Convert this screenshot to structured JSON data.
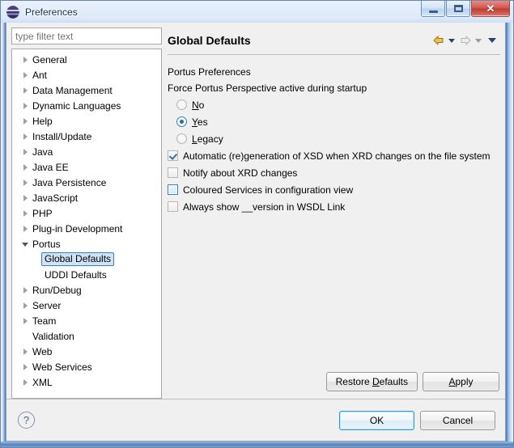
{
  "window": {
    "title": "Preferences",
    "icon": "eclipse-globe-icon",
    "minimize_label": "",
    "maximize_label": "",
    "close_label": "✕"
  },
  "filter": {
    "placeholder": "type filter text",
    "value": ""
  },
  "tree": {
    "items": [
      {
        "label": "General",
        "state": "collapsed",
        "level": 0
      },
      {
        "label": "Ant",
        "state": "collapsed",
        "level": 0
      },
      {
        "label": "Data Management",
        "state": "collapsed",
        "level": 0
      },
      {
        "label": "Dynamic Languages",
        "state": "collapsed",
        "level": 0
      },
      {
        "label": "Help",
        "state": "collapsed",
        "level": 0
      },
      {
        "label": "Install/Update",
        "state": "collapsed",
        "level": 0
      },
      {
        "label": "Java",
        "state": "collapsed",
        "level": 0
      },
      {
        "label": "Java EE",
        "state": "collapsed",
        "level": 0
      },
      {
        "label": "Java Persistence",
        "state": "collapsed",
        "level": 0
      },
      {
        "label": "JavaScript",
        "state": "collapsed",
        "level": 0
      },
      {
        "label": "PHP",
        "state": "collapsed",
        "level": 0
      },
      {
        "label": "Plug-in Development",
        "state": "collapsed",
        "level": 0
      },
      {
        "label": "Portus",
        "state": "expanded",
        "level": 0
      },
      {
        "label": "Global Defaults",
        "state": "leaf",
        "level": 1,
        "selected": true
      },
      {
        "label": "UDDI Defaults",
        "state": "leaf",
        "level": 1
      },
      {
        "label": "Run/Debug",
        "state": "collapsed",
        "level": 0
      },
      {
        "label": "Server",
        "state": "collapsed",
        "level": 0
      },
      {
        "label": "Team",
        "state": "collapsed",
        "level": 0
      },
      {
        "label": "Validation",
        "state": "leaf-top",
        "level": 0
      },
      {
        "label": "Web",
        "state": "collapsed",
        "level": 0
      },
      {
        "label": "Web Services",
        "state": "collapsed",
        "level": 0
      },
      {
        "label": "XML",
        "state": "collapsed",
        "level": 0
      }
    ]
  },
  "panel": {
    "title": "Global Defaults",
    "nav": {
      "back_icon": "arrow-left-icon",
      "back_menu_icon": "chevron-down-icon",
      "forward_icon": "arrow-right-icon",
      "forward_menu_icon": "chevron-down-icon",
      "more_icon": "chevron-down-icon"
    },
    "group_label": "Portus Preferences",
    "startup_label": "Force Portus Perspective active during startup",
    "radios": [
      {
        "label_pre": "",
        "mnemonic": "N",
        "label_post": "o",
        "checked": false
      },
      {
        "label_pre": "",
        "mnemonic": "Y",
        "label_post": "es",
        "checked": true
      },
      {
        "label_pre": "",
        "mnemonic": "L",
        "label_post": "egacy",
        "checked": false
      }
    ],
    "checkboxes": [
      {
        "label": "Automatic (re)generation of XSD when XRD changes on the file system",
        "checked": true,
        "hover": false
      },
      {
        "label": "Notify about XRD changes",
        "checked": false,
        "hover": false
      },
      {
        "label": "Coloured Services in configuration view",
        "checked": false,
        "hover": true
      },
      {
        "label": "Always show __version in WSDL Link",
        "checked": false,
        "hover": false
      }
    ],
    "restore_defaults": {
      "pre": "Restore ",
      "mnemonic": "D",
      "post": "efaults"
    },
    "apply": {
      "pre": "",
      "mnemonic": "A",
      "post": "pply"
    }
  },
  "footer": {
    "help_icon": "question-mark-icon",
    "help_glyph": "?",
    "ok_label": "OK",
    "cancel_label": "Cancel"
  },
  "colors": {
    "accent": "#3c7fb1",
    "selection_bg": "#cfe3f7",
    "panel_bg": "#f0f0f0",
    "close_button": "#c0392b",
    "nav_back": "#d9a227"
  }
}
